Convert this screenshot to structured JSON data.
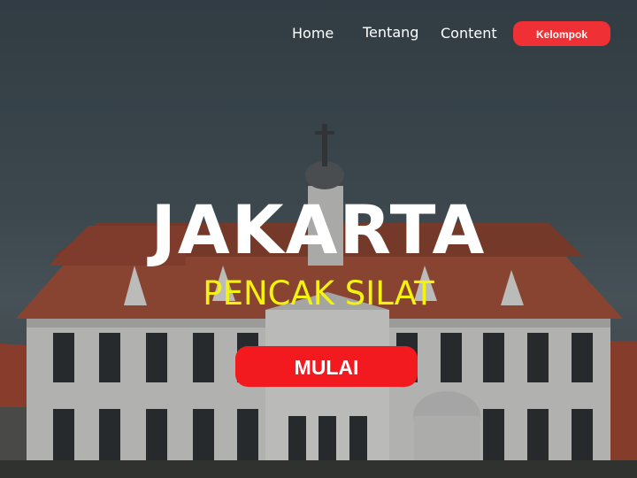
{
  "nav": {
    "home": "Home",
    "tentang": "Tentang",
    "content": "Content",
    "kelompok": "Kelompok"
  },
  "hero": {
    "title": "JAKARTA",
    "subtitle": "PENCAK SILAT",
    "cta": "MULAI"
  },
  "colors": {
    "accent": "#ef3135",
    "subtitle": "#f3f30f"
  }
}
